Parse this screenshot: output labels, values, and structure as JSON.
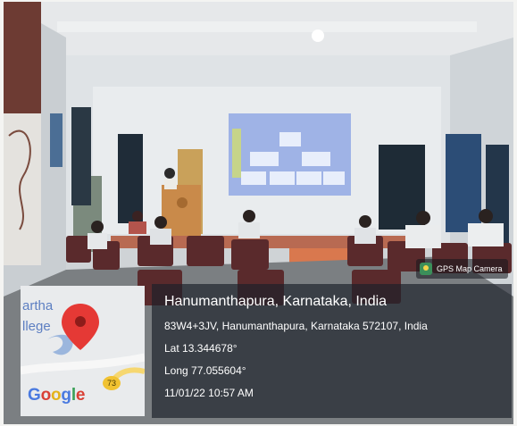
{
  "photo": {
    "description_icon": "lecture-hall-photo"
  },
  "badge": {
    "label": "GPS Map Camera",
    "icon": "gps-camera-icon"
  },
  "map_thumb": {
    "text_line1": "artha",
    "text_line2": "llege",
    "route_number": "73",
    "brand": [
      "G",
      "o",
      "o",
      "g",
      "l",
      "e"
    ]
  },
  "location": {
    "title": "Hanumanthapura, Karnataka, India",
    "address": "83W4+3JV, Hanumanthapura, Karnataka 572107, India",
    "lat": "Lat 13.344678°",
    "long": "Long 77.055604°",
    "datetime": "11/01/22 10:57 AM"
  },
  "colors": {
    "overlay": "#1c202a",
    "pin": "#e53935",
    "google_blue": "#4a7ae0",
    "google_red": "#d94035",
    "google_yellow": "#e4b31c",
    "google_green": "#3aa057"
  }
}
